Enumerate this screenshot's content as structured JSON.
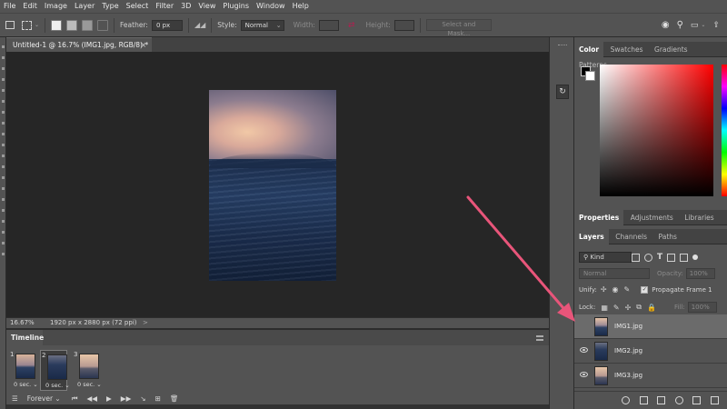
{
  "menubar": [
    "File",
    "Edit",
    "Image",
    "Layer",
    "Type",
    "Select",
    "Filter",
    "3D",
    "View",
    "Plugins",
    "Window",
    "Help"
  ],
  "options": {
    "feather_label": "Feather:",
    "feather_value": "0 px",
    "style_label": "Style:",
    "style_value": "Normal",
    "width_label": "Width:",
    "height_label": "Height:",
    "select_mask": "Select and Mask..."
  },
  "document": {
    "tab_title": "Untitled-1 @ 16.7% (IMG1.jpg, RGB/8) *",
    "close": "×"
  },
  "status": {
    "zoom": "16.67%",
    "dimensions": "1920 px x 2880 px (72 ppi)",
    "arrow": ">"
  },
  "timeline": {
    "title": "Timeline",
    "frames": [
      {
        "num": "1",
        "delay": "0 sec.",
        "selected": false
      },
      {
        "num": "2",
        "delay": "0 sec.",
        "selected": true
      },
      {
        "num": "3",
        "delay": "0 sec.",
        "selected": false
      }
    ],
    "loop": "Forever"
  },
  "panels": {
    "top_tabs": [
      "Color",
      "Swatches",
      "Gradients",
      "Patterns"
    ],
    "prop_tabs": [
      "Properties",
      "Adjustments",
      "Libraries"
    ],
    "layer_tabs": [
      "Layers",
      "Channels",
      "Paths"
    ],
    "kind": "Kind",
    "blend_mode": "Normal",
    "opacity_label": "Opacity:",
    "opacity_value": "100%",
    "unify_label": "Unify:",
    "propagate_label": "Propagate Frame 1",
    "lock_label": "Lock:",
    "fill_label": "Fill:",
    "fill_value": "100%"
  },
  "layers": [
    {
      "name": "IMG1.jpg",
      "visible": false,
      "selected": true
    },
    {
      "name": "IMG2.jpg",
      "visible": true,
      "selected": false
    },
    {
      "name": "IMG3.jpg",
      "visible": true,
      "selected": false
    }
  ],
  "colors": {
    "annotation_arrow": "#e8557a",
    "panel_bg": "#535353",
    "canvas_bg": "#262626"
  }
}
